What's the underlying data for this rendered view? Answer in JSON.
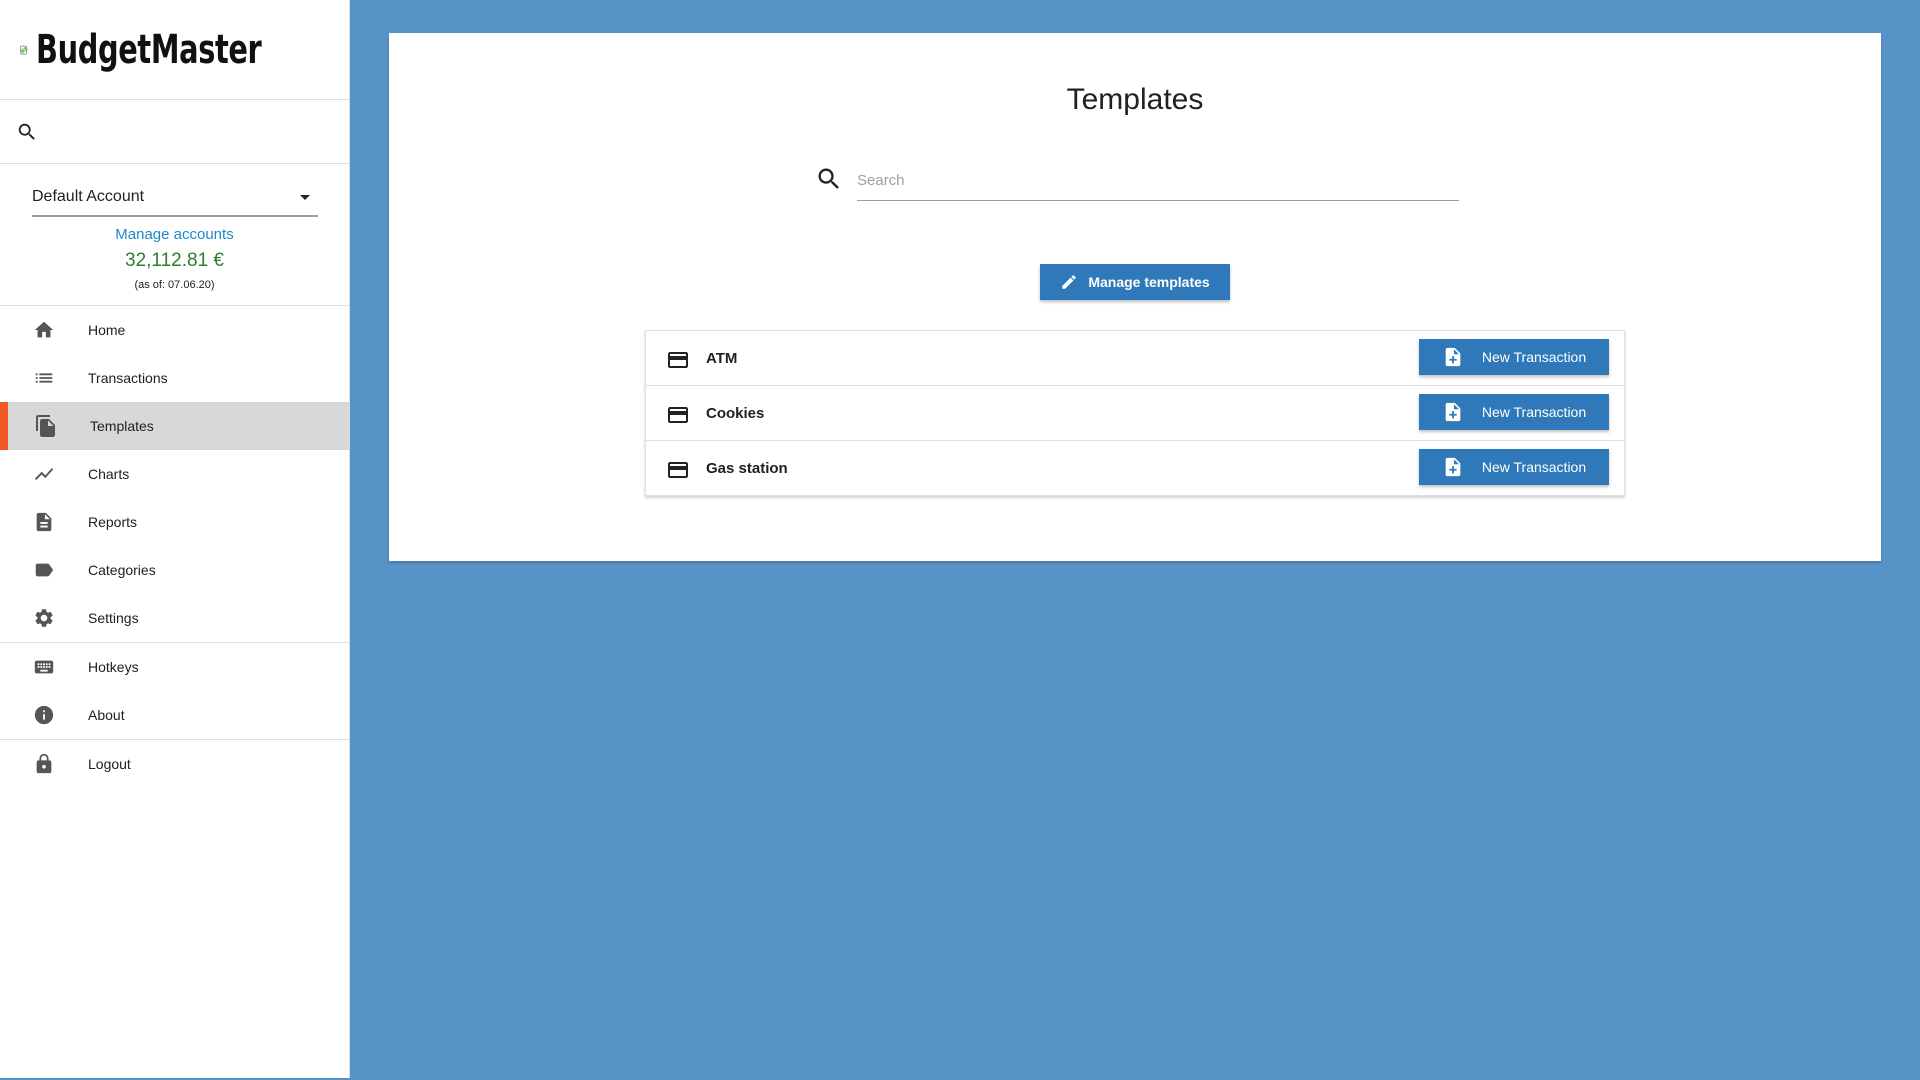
{
  "app": {
    "name": "BudgetMaster"
  },
  "account": {
    "selected": "Default Account",
    "manage_label": "Manage accounts",
    "balance": "32,112.81 €",
    "as_of": "(as of: 07.06.20)"
  },
  "nav": {
    "primary": [
      {
        "label": "Home",
        "icon": "home-icon"
      },
      {
        "label": "Transactions",
        "icon": "list-icon"
      },
      {
        "label": "Templates",
        "icon": "file-copy-icon",
        "active": true
      },
      {
        "label": "Charts",
        "icon": "line-chart-icon"
      },
      {
        "label": "Reports",
        "icon": "description-icon"
      },
      {
        "label": "Categories",
        "icon": "label-icon"
      },
      {
        "label": "Settings",
        "icon": "gear-icon"
      }
    ],
    "secondary": [
      {
        "label": "Hotkeys",
        "icon": "keyboard-icon"
      },
      {
        "label": "About",
        "icon": "info-icon"
      }
    ],
    "tertiary": [
      {
        "label": "Logout",
        "icon": "lock-icon"
      }
    ]
  },
  "main": {
    "title": "Templates",
    "search_placeholder": "Search",
    "manage_templates_label": "Manage templates",
    "templates": [
      {
        "name": "ATM",
        "action_label": "New Transaction"
      },
      {
        "name": "Cookies",
        "action_label": "New Transaction"
      },
      {
        "name": "Gas station",
        "action_label": "New Transaction"
      }
    ]
  },
  "colors": {
    "background": "#5893c8",
    "primary_button": "#2f78b9",
    "active_accent": "#f15a24",
    "balance_positive": "#2e7d32",
    "link": "#1e88c8"
  }
}
